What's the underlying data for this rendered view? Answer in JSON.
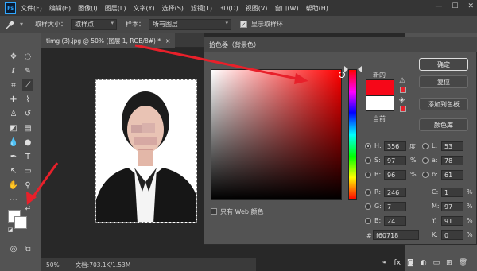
{
  "menubar": {
    "logo": "Ps",
    "items": [
      "文件(F)",
      "编辑(E)",
      "图像(I)",
      "图层(L)",
      "文字(Y)",
      "选择(S)",
      "滤镜(T)",
      "3D(D)",
      "视图(V)",
      "窗口(W)",
      "帮助(H)"
    ],
    "controls": {
      "minimize": "—",
      "maximize": "☐",
      "close": "✕"
    }
  },
  "optbar": {
    "sample_size_label": "取样大小：",
    "sample_size_value": "取样点",
    "sample_label": "样本：",
    "sample_value": "所有图层",
    "show_ring_label": "显示取样环",
    "show_ring_checked": true
  },
  "doc": {
    "tab_title": "timg (3).jpg @ 50% (图层 1, RGB/8#) *",
    "tab_close": "×",
    "zoom": "50%",
    "doc_info": "文档:703.1K/1.53M"
  },
  "dialog": {
    "title": "拾色器（背景色）",
    "new_label": "新的",
    "current_label": "当前",
    "new_color": "#f60718",
    "current_color": "#ffffff",
    "buttons": {
      "ok": "确定",
      "reset": "复位",
      "add_swatch": "添加到色板",
      "color_lib": "颜色库"
    },
    "web_only_label": "只有 Web 颜色",
    "hsb": {
      "h_label": "H:",
      "h": "356",
      "h_unit": "度",
      "s_label": "S:",
      "s": "97",
      "s_unit": "%",
      "b_label": "B:",
      "b": "96",
      "b_unit": "%"
    },
    "rgb": {
      "r_label": "R:",
      "r": "246",
      "g_label": "G:",
      "g": "7",
      "b_label": "B:",
      "b": "24"
    },
    "lab": {
      "l_label": "L:",
      "l": "53",
      "a_label": "a:",
      "a": "78",
      "b_label": "b:",
      "b": "61"
    },
    "cmyk": {
      "c_label": "C:",
      "c": "1",
      "m_label": "M:",
      "m": "97",
      "y_label": "Y:",
      "y": "91",
      "k_label": "K:",
      "k": "0",
      "unit": "%"
    },
    "hex_label": "#",
    "hex": "f60718",
    "selected_mode": "H"
  },
  "colors": {
    "foreground": "#ffffff",
    "background": "#ffffff",
    "accent": "#31a8ff",
    "arrow": "#e8202a"
  }
}
